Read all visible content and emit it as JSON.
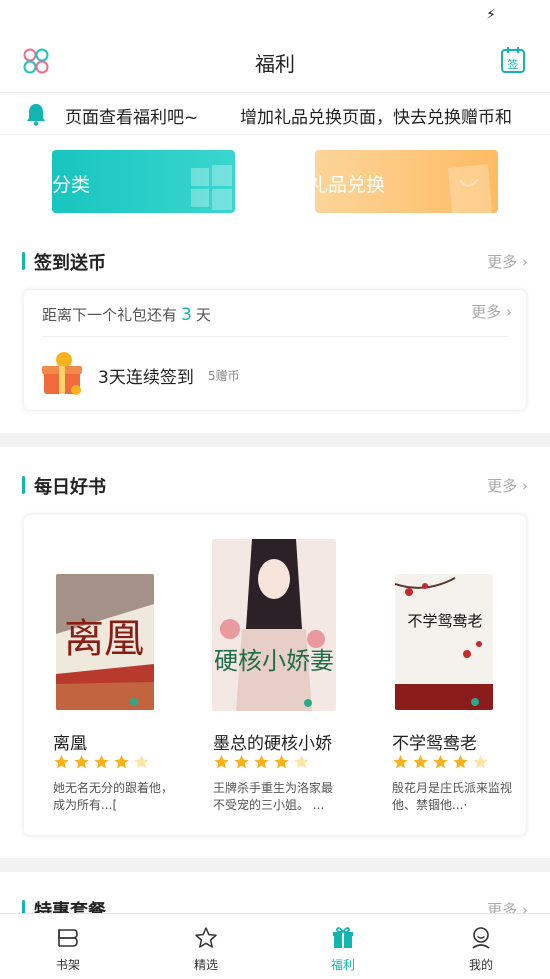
{
  "header": {
    "title": "福利"
  },
  "marquee": {
    "text_left": "页面查看福利吧~",
    "text_right": "增加礼品兑换页面，快去兑换赠币和"
  },
  "categories": [
    {
      "label": "分类"
    },
    {
      "label": "礼品兑换"
    }
  ],
  "checkin": {
    "title": "签到送币",
    "more": "更多",
    "next_gift_prefix": "距离下一个礼包还有",
    "next_gift_days": "3",
    "next_gift_suffix": "天",
    "card_more": "更多",
    "task_label": "3天连续签到",
    "task_reward": "5赠币"
  },
  "daily_books": {
    "title": "每日好书",
    "more": "更多",
    "books": [
      {
        "name": "离凰",
        "rating": 4,
        "desc": "她无名无分的跟着他，成为所有...[",
        "cover_title": "离凰"
      },
      {
        "name": "墨总的硬核小娇",
        "rating": 4,
        "desc": "王牌杀手重生为洛家最不受宠的三小姐。 ...",
        "cover_title": "硬核小娇妻"
      },
      {
        "name": "不学鸳鸯老",
        "rating": 4,
        "desc": "殷花月是庄氏派来监视他、禁锢他...·",
        "cover_title": "不学鸳鸯老"
      }
    ]
  },
  "special": {
    "title": "特惠套餐",
    "more": "更多"
  },
  "tabs": [
    {
      "label": "书架",
      "icon": "bookshelf-icon"
    },
    {
      "label": "精选",
      "icon": "star-icon"
    },
    {
      "label": "福利",
      "icon": "gift-icon",
      "active": true
    },
    {
      "label": "我的",
      "icon": "user-icon"
    }
  ],
  "colors": {
    "accent": "#13b5b1",
    "star": "#f8b21c",
    "orange": "#fdbb63"
  }
}
